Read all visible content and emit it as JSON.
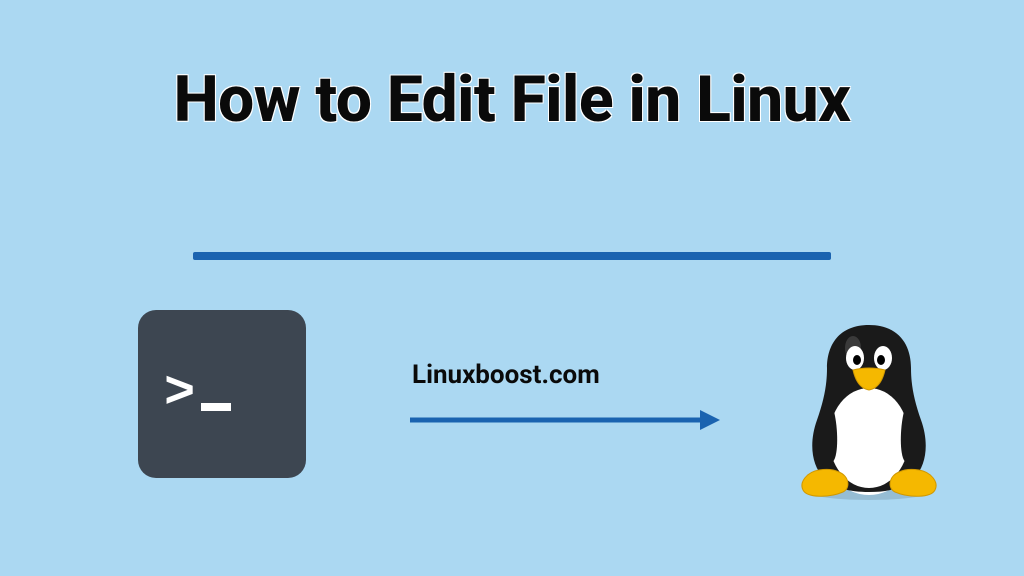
{
  "title": "How to Edit File in Linux",
  "website": "Linuxboost.com",
  "colors": {
    "background": "#ABD8F2",
    "accent": "#1A63B0",
    "terminal": "#3D4651"
  }
}
